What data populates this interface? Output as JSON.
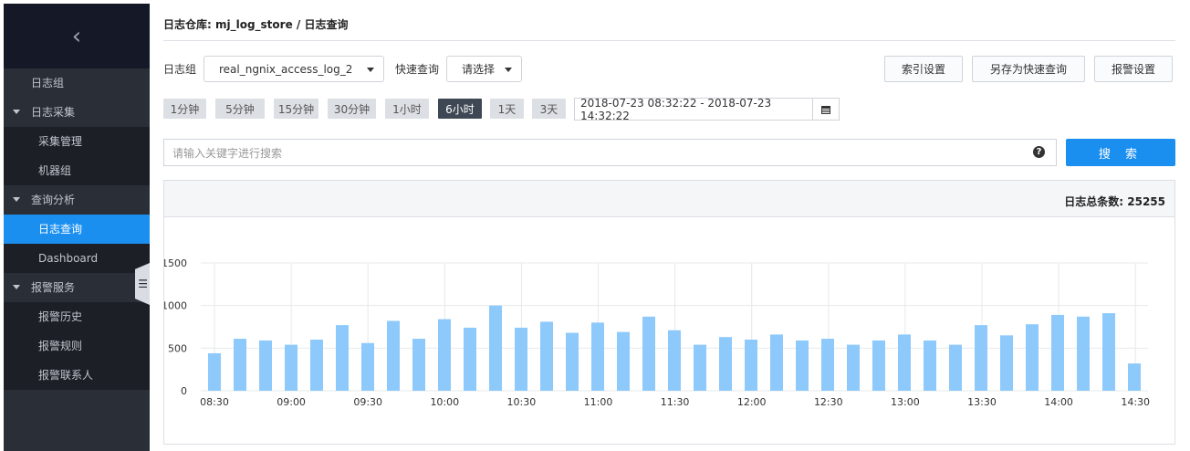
{
  "sidebar": {
    "back_icon": "chevron-left-icon",
    "items": [
      {
        "label": "日志组",
        "kind": "plain"
      },
      {
        "label": "日志采集",
        "kind": "group"
      },
      {
        "label": "采集管理",
        "kind": "sub"
      },
      {
        "label": "机器组",
        "kind": "sub"
      },
      {
        "label": "查询分析",
        "kind": "group"
      },
      {
        "label": "日志查询",
        "kind": "sub",
        "active": true
      },
      {
        "label": "Dashboard",
        "kind": "sub"
      },
      {
        "label": "报警服务",
        "kind": "group"
      },
      {
        "label": "报警历史",
        "kind": "sub"
      },
      {
        "label": "报警规则",
        "kind": "sub"
      },
      {
        "label": "报警联系人",
        "kind": "sub"
      }
    ]
  },
  "breadcrumb": {
    "text": "日志仓库: mj_log_store  /  日志查询"
  },
  "filters": {
    "logstore_label": "日志组",
    "logstore_value": "real_ngnix_access_log_2",
    "quick_query_label": "快速查询",
    "quick_query_value": "请选择"
  },
  "actions": {
    "index_settings": "索引设置",
    "save_quick_query": "另存为快速查询",
    "alarm_settings": "报警设置"
  },
  "time_range": {
    "options": [
      "1分钟",
      "5分钟",
      "15分钟",
      "30分钟",
      "1小时",
      "6小时",
      "1天",
      "3天"
    ],
    "selected": "6小时",
    "range_text": "2018-07-23 08:32:22 - 2018-07-23 14:32:22"
  },
  "search": {
    "placeholder": "请输入关键字进行搜索",
    "help_icon": "question-circle-icon",
    "button_label": "搜 索"
  },
  "summary": {
    "total_text": "日志总条数: 25255"
  },
  "colors": {
    "accent": "#1b8ff0",
    "bar": "#8ec9fb",
    "sidebar_bg": "#2a2f37"
  },
  "chart_data": {
    "type": "bar",
    "ylim": [
      0,
      1500
    ],
    "y_ticks": [
      0,
      500,
      1000,
      1500
    ],
    "y_tick_labels": [
      "0",
      "500",
      "1000",
      "1500"
    ],
    "x_tick_labels": [
      "08:30",
      "09:00",
      "09:30",
      "10:00",
      "10:30",
      "11:00",
      "11:30",
      "12:00",
      "12:30",
      "13:00",
      "13:30",
      "14:00",
      "14:30"
    ],
    "grid": true,
    "values": [
      440,
      610,
      590,
      540,
      600,
      770,
      560,
      820,
      610,
      840,
      740,
      1000,
      740,
      810,
      680,
      800,
      690,
      870,
      710,
      540,
      630,
      600,
      660,
      590,
      610,
      540,
      590,
      660,
      590,
      540,
      770,
      650,
      780,
      890,
      870,
      910,
      320
    ]
  }
}
